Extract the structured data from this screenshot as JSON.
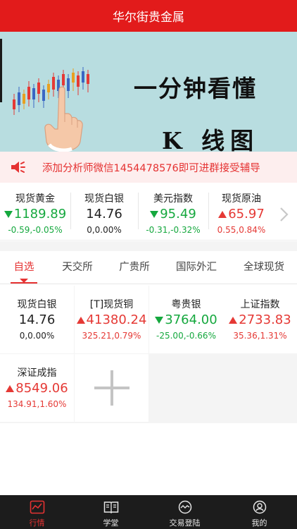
{
  "header": {
    "title": "华尔街贵金属"
  },
  "banner": {
    "line1": "一分钟看懂",
    "line2": "K 线图"
  },
  "notice": {
    "text": "添加分析师微信1454478576即可进群接受辅导"
  },
  "quotes": [
    {
      "name": "现货黄金",
      "price": "1189.89",
      "change": "-0.59,-0.05%",
      "trend": "down"
    },
    {
      "name": "现货白银",
      "price": "14.76",
      "change": "0,0.00%",
      "trend": "flat"
    },
    {
      "name": "美元指数",
      "price": "95.49",
      "change": "-0.31,-0.32%",
      "trend": "down"
    },
    {
      "name": "现货原油",
      "price": "65.97",
      "change": "0.55,0.84%",
      "trend": "up"
    }
  ],
  "tabs": [
    {
      "label": "自选",
      "active": true
    },
    {
      "label": "天交所",
      "active": false
    },
    {
      "label": "广贵所",
      "active": false
    },
    {
      "label": "国际外汇",
      "active": false
    },
    {
      "label": "全球现货",
      "active": false
    }
  ],
  "watchlist": [
    {
      "name": "现货白银",
      "price": "14.76",
      "change": "0,0.00%",
      "trend": "flat"
    },
    {
      "name": "[T]现货铜",
      "price": "41380.24",
      "change": "325.21,0.79%",
      "trend": "up"
    },
    {
      "name": "粤贵银",
      "price": "3764.00",
      "change": "-25.00,-0.66%",
      "trend": "down"
    },
    {
      "name": "上证指数",
      "price": "2733.83",
      "change": "35.36,1.31%",
      "trend": "up"
    },
    {
      "name": "深证成指",
      "price": "8549.06",
      "change": "134.91,1.60%",
      "trend": "up"
    }
  ],
  "nav": [
    {
      "label": "行情",
      "icon": "chart-icon",
      "active": true
    },
    {
      "label": "学堂",
      "icon": "book-icon",
      "active": false
    },
    {
      "label": "交易登陆",
      "icon": "trade-icon",
      "active": false
    },
    {
      "label": "我的",
      "icon": "user-icon",
      "active": false
    }
  ],
  "colors": {
    "brand": "#e21b1b",
    "up": "#e53935",
    "down": "#15a83e"
  }
}
